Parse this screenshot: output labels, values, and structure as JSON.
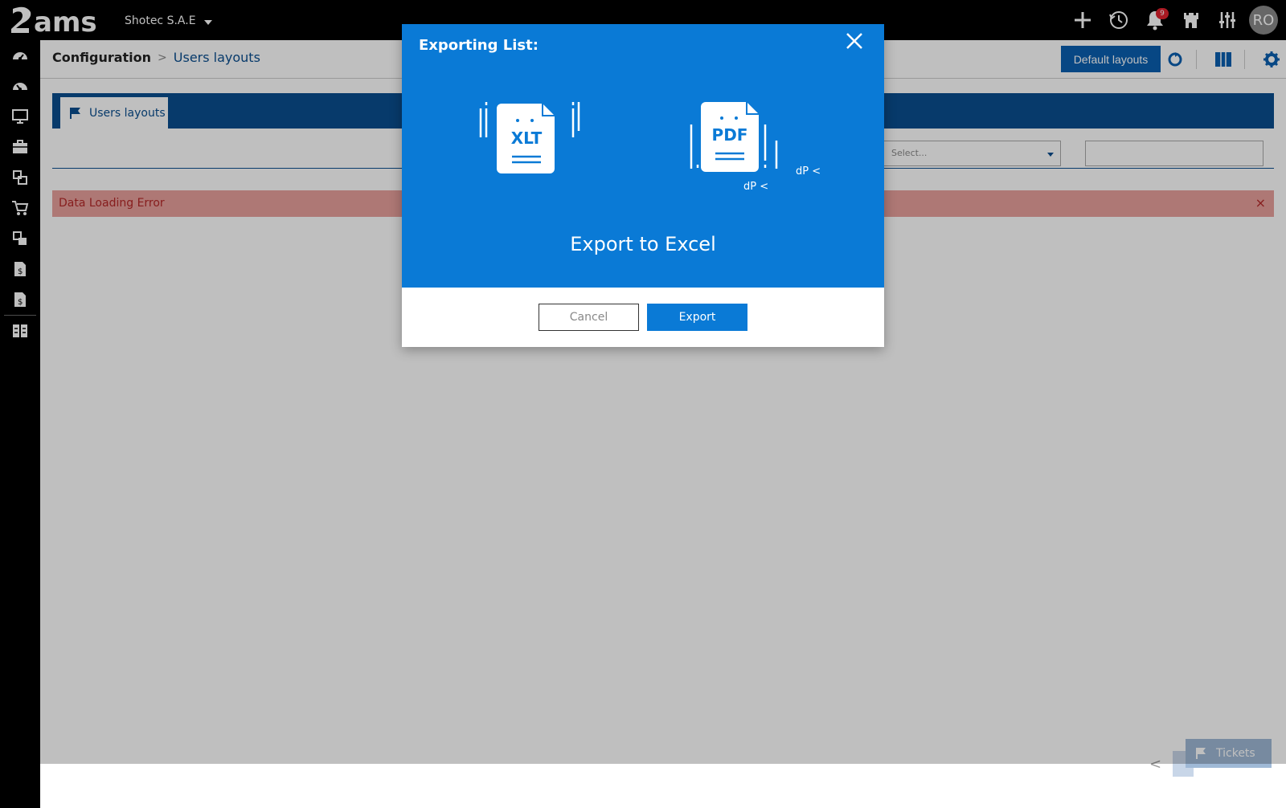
{
  "app": {
    "logo_text": "?ams",
    "company": "Shotec S.A.E"
  },
  "topbar": {
    "icons": [
      "plus-icon",
      "history-icon",
      "bell-icon",
      "castle-icon",
      "sliders-icon"
    ],
    "notification_count": "9",
    "avatar_initials": "RO"
  },
  "sidebar": {
    "items": [
      "dashboard-icon",
      "dashboard-alt-icon",
      "monitor-icon",
      "briefcase-icon",
      "modules-icon",
      "cart-icon",
      "modules-alt-icon",
      "invoice-icon",
      "invoice-alt-icon",
      "columns-icon"
    ]
  },
  "header": {
    "breadcrumb_root": "Configuration",
    "breadcrumb_current": "Users layouts",
    "default_layouts_label": "Default layouts"
  },
  "tabs": [
    {
      "label": "Users layouts"
    }
  ],
  "filters": {
    "select_placeholder": "Select..."
  },
  "error": {
    "message": "Data Loading Error",
    "close": "×"
  },
  "tickets": {
    "label": "Tickets"
  },
  "modal": {
    "title": "Exporting List:",
    "xlt_label": "XLT",
    "pdf_label": "PDF",
    "pdf_side_text_1": "dP <",
    "pdf_side_text_2": "dP <",
    "heading": "Export to Excel",
    "cancel_label": "Cancel",
    "export_label": "Export"
  },
  "colors": {
    "primary": "#0a7ad6",
    "dark_blue": "#0a4e8f",
    "error_bg": "#e8a09d",
    "badge": "#e0222e"
  }
}
